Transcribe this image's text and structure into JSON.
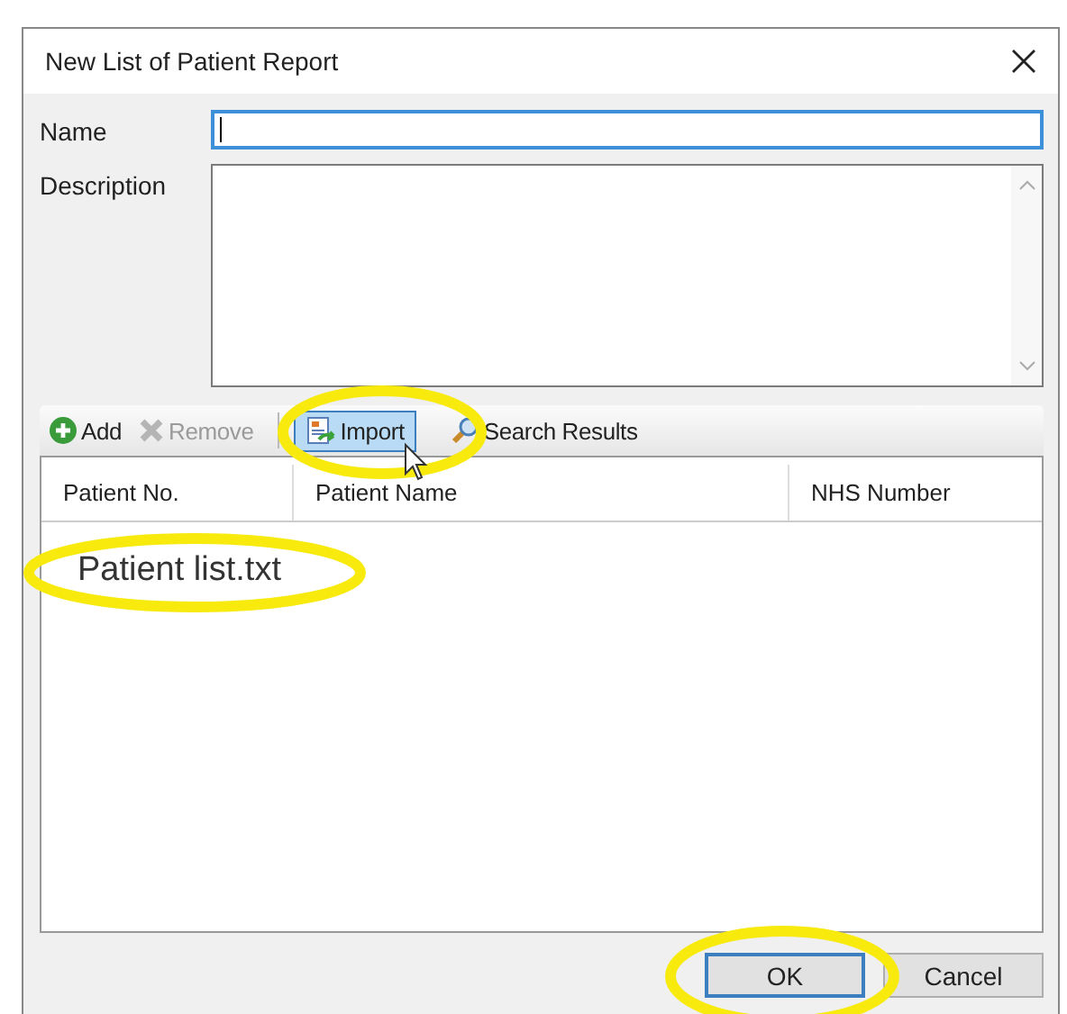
{
  "window": {
    "title": "New List of Patient Report"
  },
  "fields": [
    {
      "label": "Name",
      "kind": "line",
      "focused": true
    },
    {
      "label": "Description",
      "kind": "multiline",
      "focused": false
    }
  ],
  "toolbar": [
    {
      "kind": "add",
      "label": "Add",
      "disabled": false,
      "selected": false
    },
    {
      "kind": "remove",
      "label": "Remove",
      "disabled": true,
      "selected": false
    },
    {
      "kind": "import",
      "label": "Import",
      "disabled": false,
      "selected": true
    },
    {
      "kind": "search",
      "label": "Search Results",
      "disabled": false,
      "selected": false
    }
  ],
  "table": {
    "columns": [
      "Patient No.",
      "Patient Name",
      "NHS Number"
    ]
  },
  "annotation": {
    "text": "Patient list.txt"
  },
  "buttons": [
    {
      "label": "OK",
      "default": true
    },
    {
      "label": "Cancel",
      "default": false
    }
  ]
}
